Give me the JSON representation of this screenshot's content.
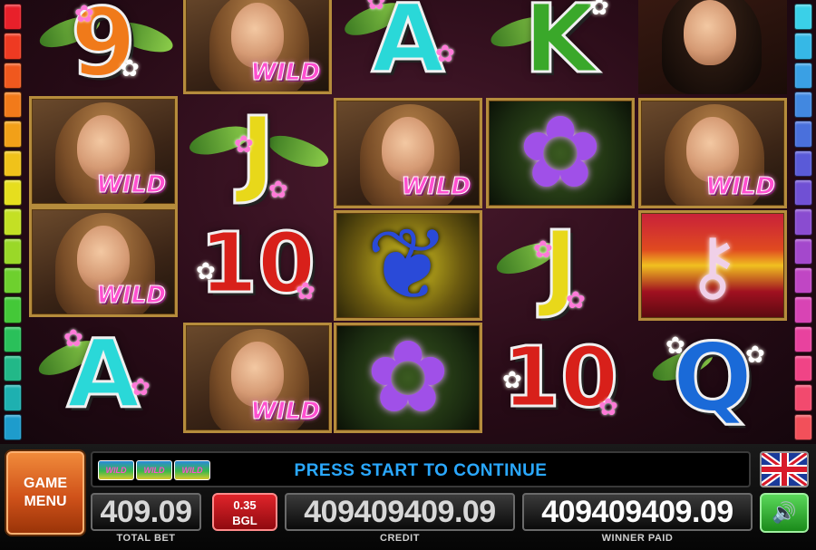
{
  "symbols": {
    "wild": "WILD",
    "reel1": [
      "9",
      "",
      "",
      "A"
    ],
    "reel2": [
      "",
      "J",
      "10",
      ""
    ],
    "reel3": [
      "A",
      "",
      "",
      ""
    ],
    "reel4": [
      "K",
      "",
      "J",
      "10"
    ],
    "reel5": [
      "",
      "",
      "",
      "Q"
    ]
  },
  "panel": {
    "game_menu_line1": "GAME",
    "game_menu_line2": "MENU",
    "message": "PRESS START TO CONTINUE",
    "mini_logos": [
      "WILD",
      "WILD",
      "WILD"
    ],
    "total_bet": "409.09",
    "total_bet_label": "TOTAL BET",
    "bet_value": "0.35",
    "bet_currency": "BGL",
    "credit": "409409409.09",
    "credit_label": "CREDIT",
    "winner_paid": "409409409.09",
    "winner_paid_label": "WINNER PAID"
  },
  "colors": {
    "letter_9": "#f07a1a",
    "letter_A": "#2ad8d8",
    "letter_K": "#3aa82a",
    "letter_J": "#e8d81a",
    "letter_10": "#d8201a",
    "letter_Q": "#1a6ad8",
    "message_text": "#2aa8ff",
    "wild_text": "#ff4fd0"
  },
  "icons": {
    "flag": "uk-flag-icon",
    "sound": "speaker-icon"
  }
}
